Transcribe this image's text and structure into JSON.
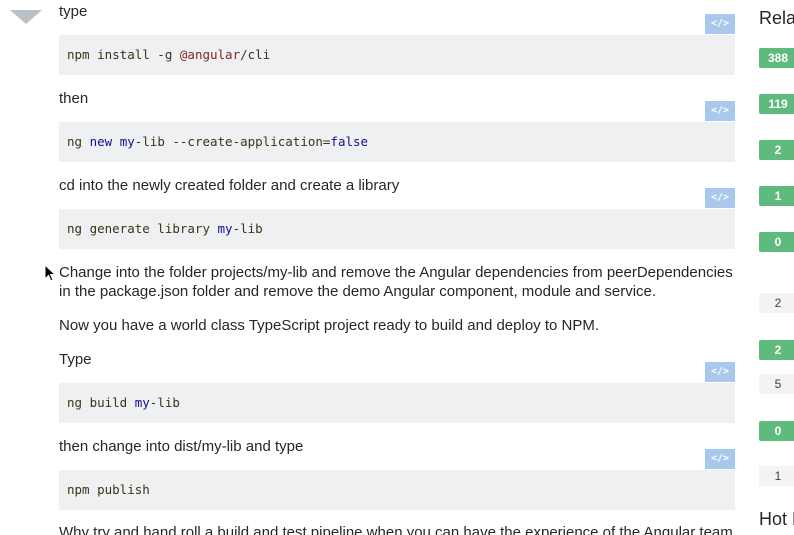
{
  "post": {
    "paragraphs": {
      "type_lower": "type",
      "then": "then",
      "cd": "cd into the newly created folder and create a library",
      "change": "Change into the folder projects/my-lib and remove the Angular dependencies from peerDependencies in the package.json folder and remove the demo Angular component, module and service.",
      "world": "Now you have a world class TypeScript project ready to build and deploy to NPM.",
      "type_upper": "Type",
      "dist": "then change into dist/my-lib and type",
      "why": "Why try and hand roll a build and test pipeline when you can have the experience of the Angular team"
    },
    "code": {
      "c1": {
        "a": "npm install -g ",
        "b": "@angular",
        "c": "/cli"
      },
      "c2": {
        "a": "ng ",
        "b": "new",
        "c": " ",
        "d": "my",
        "e": "-lib --create-application=",
        "f": "false"
      },
      "c3": {
        "a": "ng generate library ",
        "b": "my",
        "c": "-lib"
      },
      "c4": {
        "a": "ng build ",
        "b": "my",
        "c": "-lib"
      },
      "c5": {
        "a": "npm publish"
      }
    },
    "snippet_label": "</>"
  },
  "sidebar": {
    "related_heading": "Related",
    "hot_heading": "Hot Network Questions",
    "scores": [
      "388",
      "119",
      "2",
      "1",
      "0",
      "2",
      "2",
      "5",
      "0",
      "1"
    ]
  },
  "colors": {
    "answered_badge": "#5eba7d",
    "snippet_button": "#a8c8ee",
    "code_background": "#eff0f1"
  }
}
